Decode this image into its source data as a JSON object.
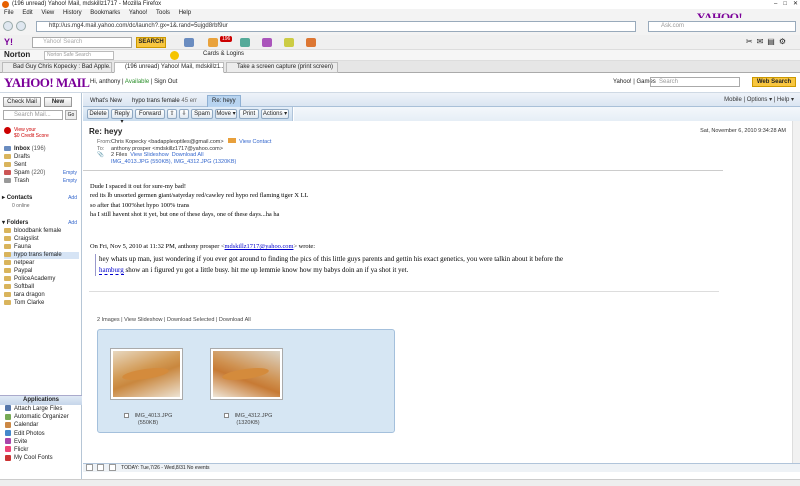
{
  "window": {
    "title": "(196 unread) Yahoo! Mail, mdskillz1717 - Mozilla Firefox"
  },
  "menu": [
    "File",
    "Edit",
    "View",
    "History",
    "Bookmarks",
    "Yahoo!",
    "Tools",
    "Help"
  ],
  "browser_logo": "YAHOO!",
  "url": "http://us.mg4.mail.yahoo.com/dc/launch?.gx=1&.rand=5ujgd8rbf9ur",
  "search_placeholder": "Ask.com",
  "yahoo_toolbar": {
    "search_placeholder": "Yahoo! Search",
    "search_label": "SEARCH",
    "badge": "196"
  },
  "norton": {
    "label": "Norton",
    "search_placeholder": "Norton Safe Search",
    "cards_label": "Cards & Logins"
  },
  "tabs": [
    "Bad Guy Chris Kopecky : Bad Apple...",
    "(196 unread) Yahoo! Mail, mdskillz1...",
    "Take a screen capture (print screen)"
  ],
  "ymail": {
    "logo": "YAHOO! MAIL",
    "greeting": "Hi, anthony",
    "status": "Available",
    "sign_out": "Sign Out",
    "links": "Yahoo! | Games",
    "search_placeholder": "Search",
    "web_search": "Web Search"
  },
  "left": {
    "check_mail": "Check Mail",
    "new": "New",
    "search_placeholder": "Search Mail...",
    "go": "Go",
    "credit": [
      "View your",
      "$0 Credit Score"
    ],
    "mailboxes": [
      {
        "name": "Inbox",
        "count": "(196)",
        "action": ""
      },
      {
        "name": "Drafts",
        "count": "",
        "action": ""
      },
      {
        "name": "Sent",
        "count": "",
        "action": ""
      },
      {
        "name": "Spam",
        "count": "(220)",
        "action": "Empty"
      },
      {
        "name": "Trash",
        "count": "",
        "action": "Empty"
      }
    ],
    "contacts_label": "Contacts",
    "contacts_add": "Add",
    "contacts_status": "0 online",
    "folders_label": "Folders",
    "folders_add": "Add",
    "folders": [
      "bloodbank female",
      "Craigslist",
      "Fauna",
      "hypo trans female",
      "netpear",
      "Paypal",
      "PoliceAcademy",
      "Softball",
      "tara dragon",
      "Tom Clarke"
    ],
    "apps_label": "Applications",
    "apps": [
      "Attach Large Files",
      "Automatic Organizer",
      "Calendar",
      "Edit Photos",
      "Evite",
      "Flickr",
      "My Cool Fonts"
    ]
  },
  "main": {
    "tabs": [
      "What's New",
      "hypo trans female",
      "45 err",
      "Re: heyy"
    ],
    "tools": "Mobile | Options ▾ | Help ▾",
    "actions": [
      "Delete",
      "Reply ▾",
      "Forward",
      "Spam",
      "Move ▾",
      "Print",
      "Actions ▾"
    ],
    "subject": "Re: heyy",
    "date": "Sat, November 6, 2010 9:34:28 AM",
    "from_label": "From:",
    "from": "Chris Kopecky <badappleoptiles@gmail.com>",
    "view_contact": "View Contact",
    "to_label": "To:",
    "to": "anthony prosper <mdskillz1717@yahoo.com>",
    "files": "2 Files",
    "view_slideshow": "View Slideshow",
    "download_all": "Download All",
    "file_names": "IMG_4013.JPG (550KB), IMG_4312.JPG (1320KB)",
    "body": [
      "Dude I spaced it out for sure-my bad!",
      "red its lb unsorted germen giant/satyrday red/cawley red hypo red flaming tiger X LL",
      "so after that 100%het hypo 100% trans",
      "ha I still havent shot it yet, but one of these days, one of these days...ha ha"
    ],
    "quote_intro_before": "On Fri, Nov 5, 2010 at 11:32 PM, anthony prosper <",
    "quote_email": "mdskillz1717@yahoo.com",
    "quote_intro_after": "> wrote:",
    "quote_line1": "hey whats up man, just wondering if you ever got around to finding the pics of this little guys parents and gettin his exact genetics, you were talkin about it before the",
    "quote_word": "hamburg",
    "quote_line2_rest": " show an i figured yu got a little busy. hit me up lemmie know how my babys doin an if ya shot it yet.",
    "image_links": "2 Images | View Slideshow | Download Selected | Download All",
    "images": [
      {
        "name": "IMG_4013.JPG",
        "size": "(550KB)"
      },
      {
        "name": "IMG_4312.JPG",
        "size": "(1320KB)"
      }
    ],
    "cal_bar": "TODAY: Tue,7/26 - Wed,8/31  No events"
  }
}
